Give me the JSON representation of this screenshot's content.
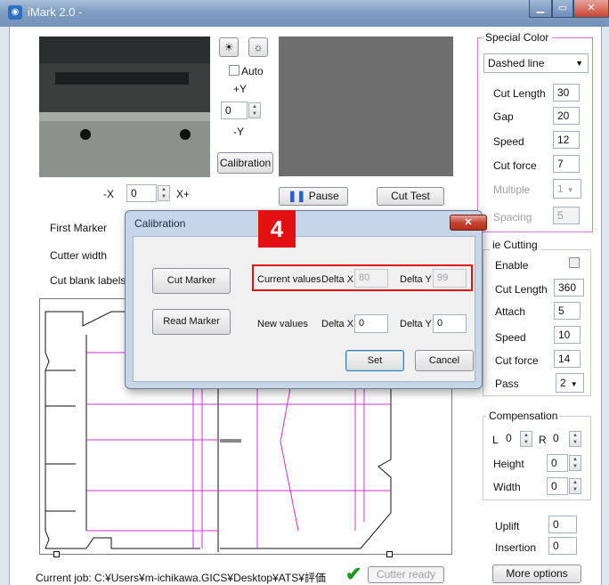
{
  "window": {
    "title": "iMark 2.0 -",
    "app_icon": "eye-icon"
  },
  "top_controls": {
    "auto_label": "Auto",
    "plus_y": "+Y",
    "minus_y": "-Y",
    "y_value": "0",
    "calibration_button": "Calibration",
    "minus_x": "-X",
    "x_value": "0",
    "plus_x": "X+",
    "pause_button": "Pause",
    "cut_test_button": "Cut Test"
  },
  "left_labels": {
    "first_marker": "First Marker",
    "cutter_width": "Cutter width",
    "cut_blank_labels": "Cut blank labels"
  },
  "special_color": {
    "title": "Special Color",
    "line_type": "Dashed line",
    "cut_length_label": "Cut Length",
    "cut_length": "30",
    "gap_label": "Gap",
    "gap": "20",
    "speed_label": "Speed",
    "speed": "12",
    "cutforce_label": "Cut force",
    "cutforce": "7",
    "multiple_label": "Multiple",
    "multiple": "1",
    "spacing_label": "Spacing",
    "spacing": "5"
  },
  "die_cutting": {
    "title": "ie Cutting",
    "enable_label": "Enable",
    "cut_length_label": "Cut Length",
    "cut_length": "360",
    "attach_label": "Attach",
    "attach": "5",
    "speed_label": "Speed",
    "speed": "10",
    "cutforce_label": "Cut force",
    "cutforce": "14",
    "pass_label": "Pass",
    "pass": "2"
  },
  "compensation": {
    "title": "Compensation",
    "l_label": "L",
    "l_value": "0",
    "r_label": "R",
    "r_value": "0",
    "height_label": "Height",
    "height": "0",
    "width_label": "Width",
    "width": "0"
  },
  "extra": {
    "uplift_label": "Uplift",
    "uplift": "0",
    "insertion_label": "Insertion",
    "insertion": "0",
    "more_options_button": "More options"
  },
  "status": {
    "current_job": "Current job: C:¥Users¥m-ichikawa.GICS¥Desktop¥ATS¥評価",
    "cutter_ready": "Cutter ready",
    "ok_color": "#1a9a1a"
  },
  "dialog": {
    "title": "Calibration",
    "cut_marker_button": "Cut Marker",
    "read_marker_button": "Read Marker",
    "current_values_label": "Current values",
    "delta_x_label": "Delta X",
    "current_dx": "80",
    "delta_y_label": "Delta Y",
    "current_dy": "99",
    "new_values_label": "New values",
    "new_dx": "0",
    "new_dy": "0",
    "set_button": "Set",
    "cancel_button": "Cancel"
  },
  "annotation": {
    "step": "4",
    "color": "#e21010"
  },
  "colors": {
    "accent_pink": "#d779d8",
    "drawing_line": "#cc33cc"
  }
}
